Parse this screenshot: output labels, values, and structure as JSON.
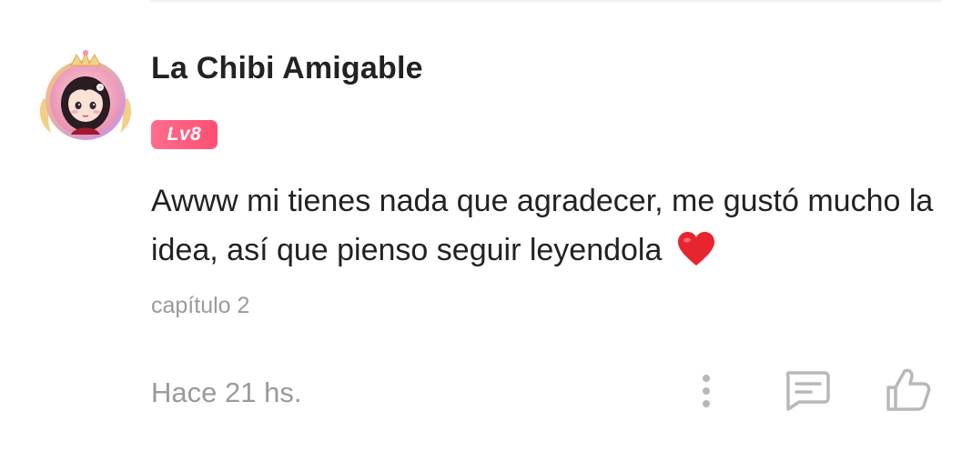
{
  "comment": {
    "author": "La Chibi Amigable",
    "level": "Lv8",
    "text": "Awww mi tienes nada que agradecer, me gustó mucho la idea, así que pienso seguir leyendola",
    "emoji": "heart-icon",
    "chapter": "capítulo 2",
    "time": "Hace 21 hs."
  },
  "actions": {
    "more": "more-options-icon",
    "reply": "reply-icon",
    "like": "thumbs-up-icon"
  },
  "colors": {
    "badge": "#ff5a7b",
    "text_primary": "#222222",
    "text_secondary": "#9a9a9a",
    "heart": "#e8242f"
  }
}
